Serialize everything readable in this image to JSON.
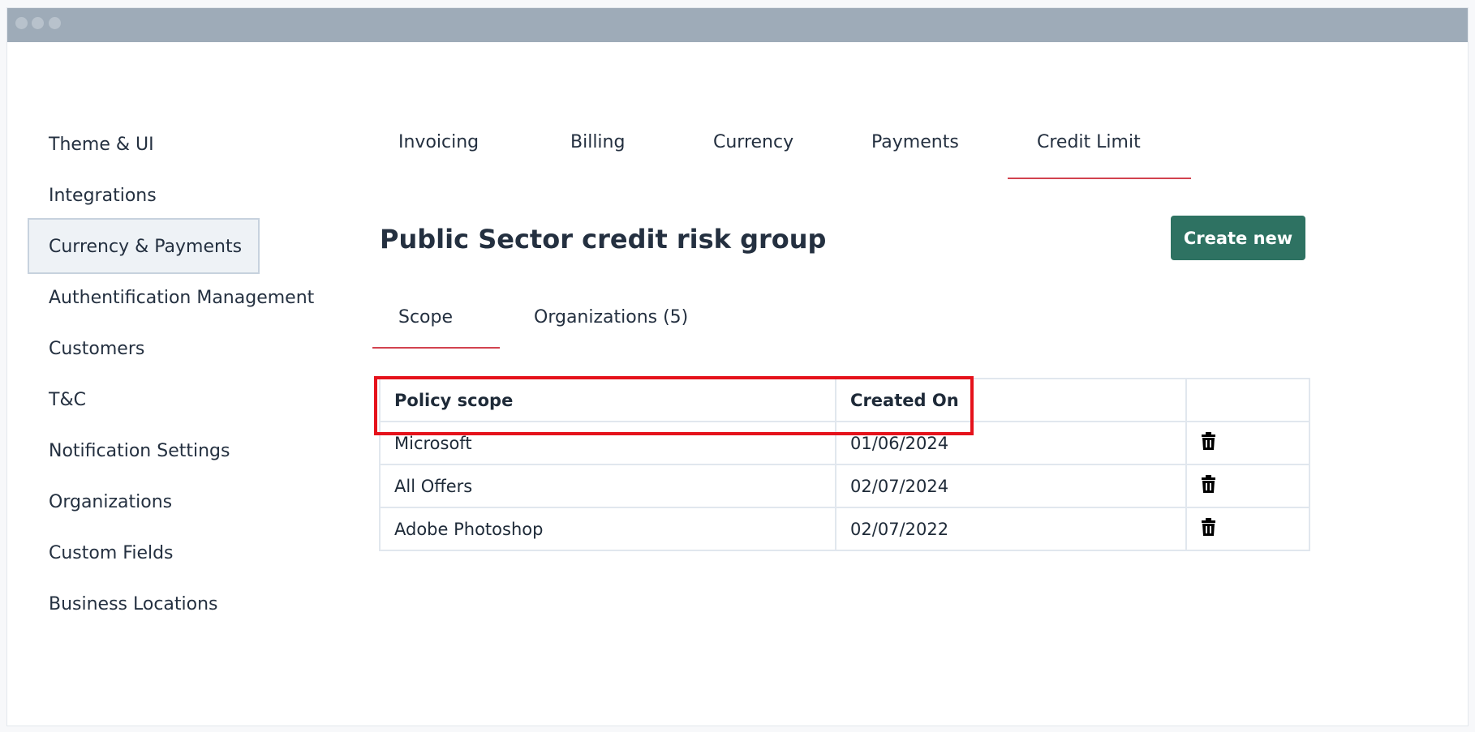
{
  "sidebar": {
    "items": [
      {
        "label": "Theme & UI"
      },
      {
        "label": "Integrations"
      },
      {
        "label": "Currency & Payments"
      },
      {
        "label": "Authentification Management"
      },
      {
        "label": "Customers"
      },
      {
        "label": "T&C"
      },
      {
        "label": "Notification Settings"
      },
      {
        "label": "Organizations"
      },
      {
        "label": "Custom Fields"
      },
      {
        "label": "Business Locations"
      }
    ],
    "active": "Currency & Payments"
  },
  "tabs": [
    {
      "label": "Invoicing"
    },
    {
      "label": "Billing"
    },
    {
      "label": "Currency"
    },
    {
      "label": "Payments"
    },
    {
      "label": "Credit Limit"
    }
  ],
  "active_tab": "Credit Limit",
  "page": {
    "title": "Public Sector credit risk group",
    "create_label": "Create new"
  },
  "subtabs": [
    {
      "label": "Scope"
    },
    {
      "label": "Organizations (5)"
    }
  ],
  "active_subtab": "Scope",
  "table": {
    "headers": [
      "Policy scope",
      "Created On",
      ""
    ],
    "rows": [
      {
        "scope": "Microsoft",
        "created": "01/06/2024"
      },
      {
        "scope": "All Offers",
        "created": "02/07/2024"
      },
      {
        "scope": "Adobe Photoshop",
        "created": "02/07/2022"
      }
    ]
  },
  "colors": {
    "accent_red": "#d2434f",
    "button_green": "#2e7262",
    "highlight_red": "#e5121b",
    "titlebar": "#9eabb8"
  },
  "icons": {
    "delete": "trash-icon"
  }
}
